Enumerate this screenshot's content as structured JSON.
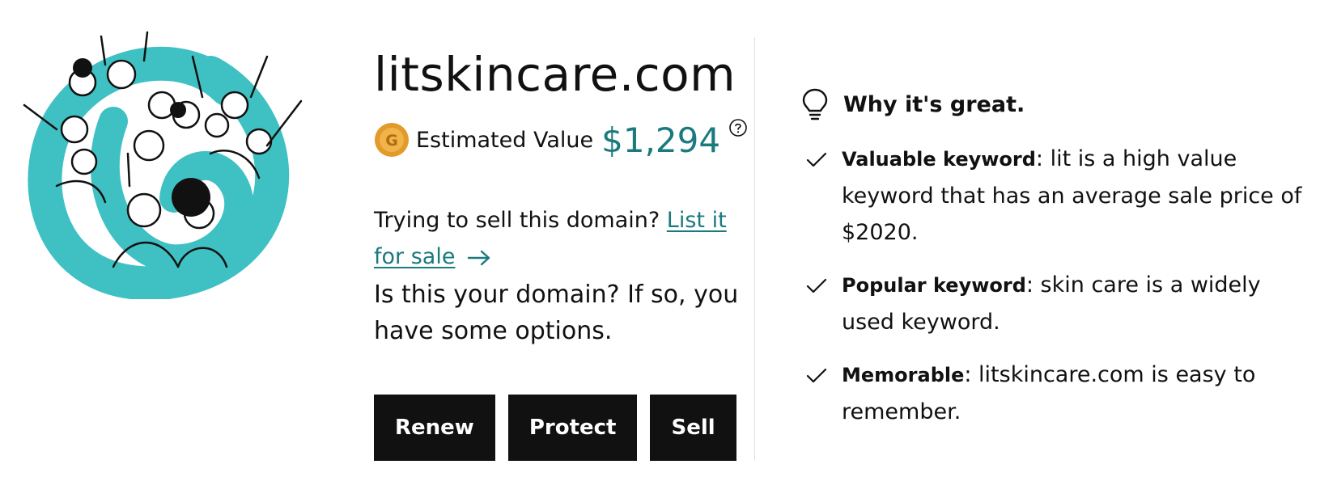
{
  "domain": "litskincare.com",
  "estimate": {
    "label": "Estimated Value",
    "value": "$1,294",
    "coin_letter": "G"
  },
  "sell": {
    "prompt": "Trying to sell this domain?",
    "link_label": "List it for sale"
  },
  "owner_question": "Is this your domain? If so, you have some options.",
  "actions": [
    "Renew",
    "Protect",
    "Sell"
  ],
  "why": {
    "title": "Why it's great.",
    "reasons": [
      {
        "title": "Valuable keyword",
        "text": ": lit is a high value keyword that has an average sale price of $2020."
      },
      {
        "title": "Popular keyword",
        "text": ": skin care is a widely used keyword."
      },
      {
        "title": "Memorable",
        "text": ": litskincare.com is easy to remember."
      }
    ]
  },
  "colors": {
    "accent": "#1a7a7e",
    "illustration_teal": "#3fc1c4",
    "coin": "#e29a2a",
    "button": "#111111"
  },
  "icons": [
    "lightbulb-icon",
    "check-icon",
    "help-icon",
    "arrow-right-icon",
    "coin-icon"
  ]
}
